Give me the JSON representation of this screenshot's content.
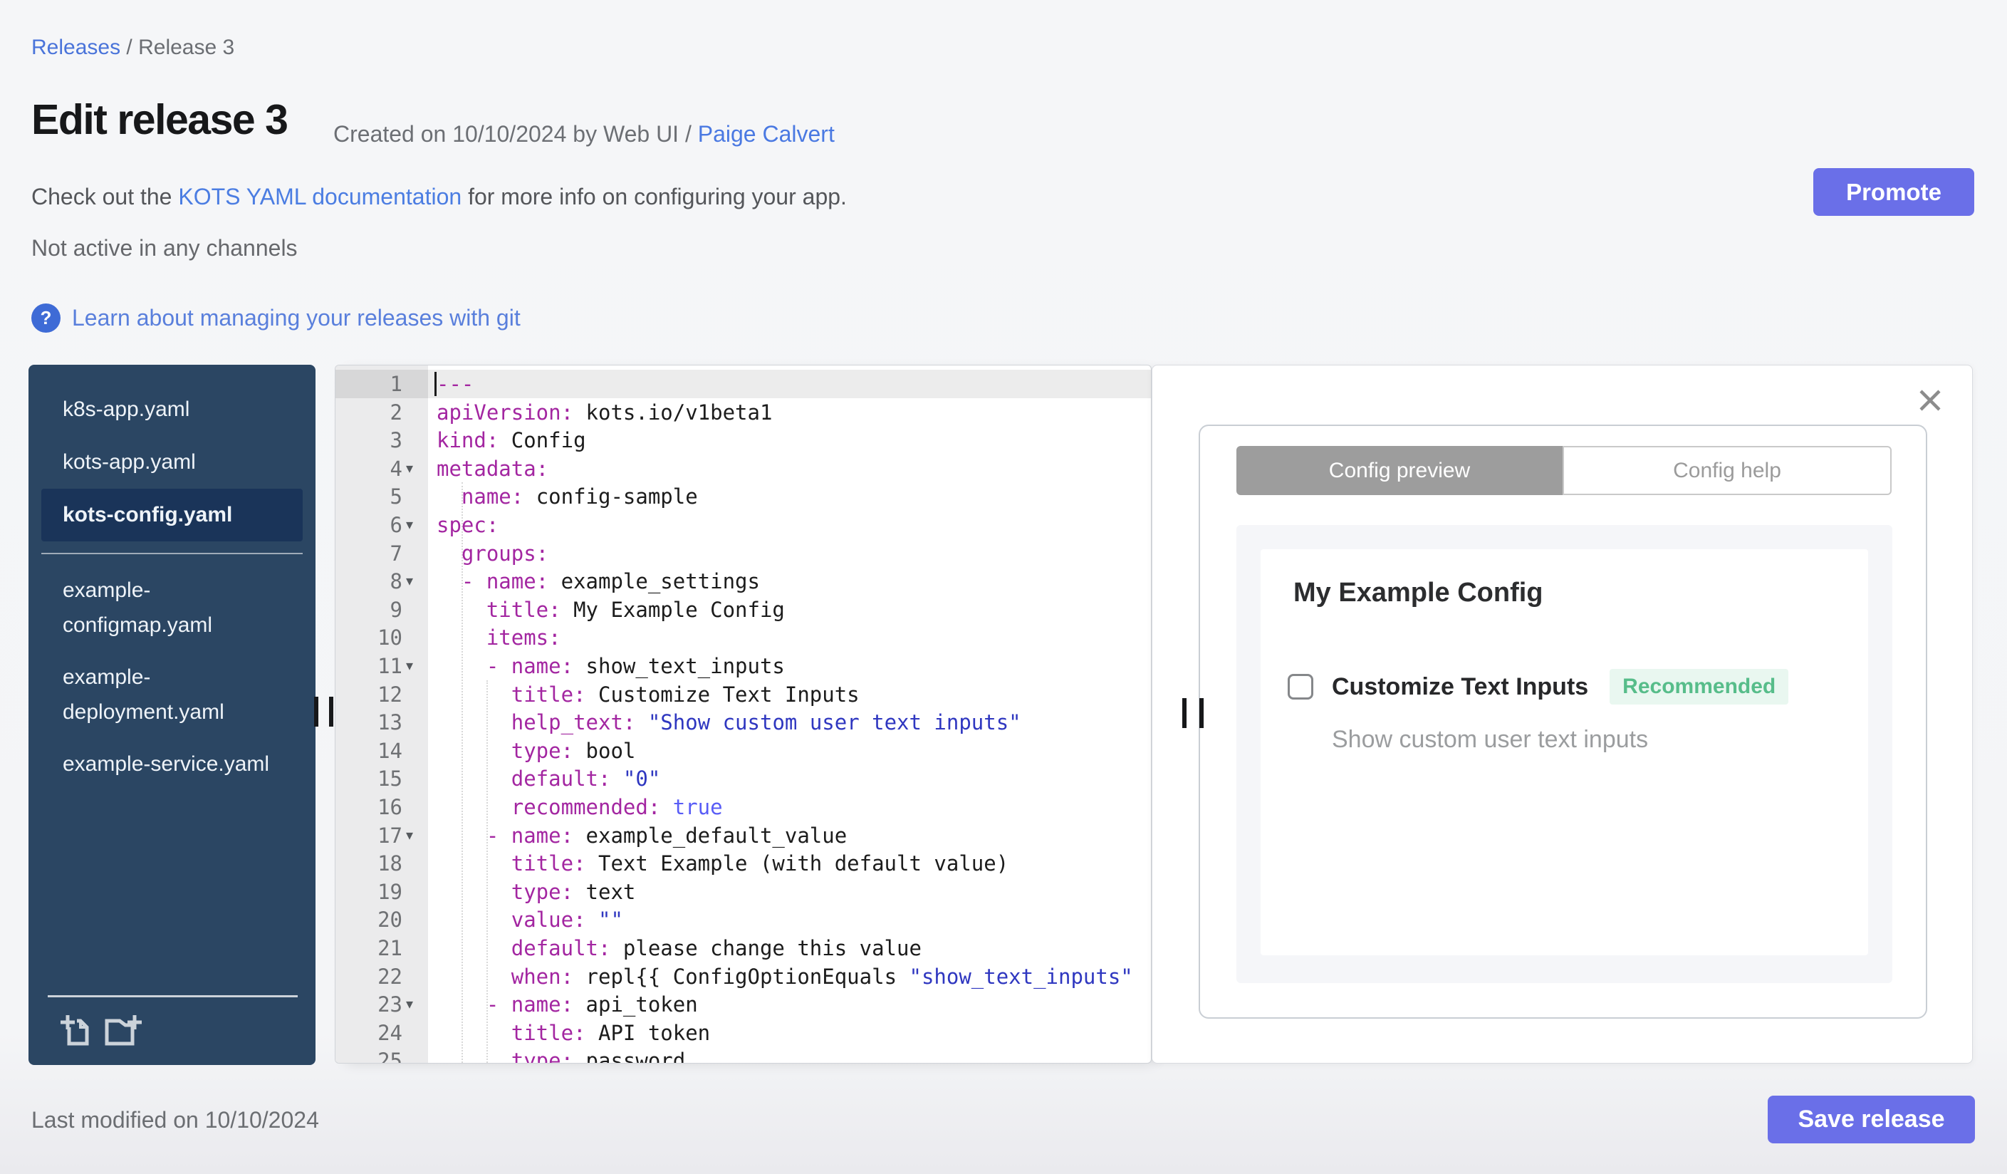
{
  "header": {
    "breadcrumb": {
      "releases": "Releases",
      "separator": " / ",
      "current": "Release 3"
    },
    "title": "Edit release 3",
    "created": {
      "prefix": "Created on 10/10/2024 by Web UI / ",
      "author": "Paige Calvert"
    },
    "docs": {
      "before": "Check out the ",
      "link": "KOTS YAML documentation",
      "after": " for more info on configuring your app."
    },
    "status": "Not active in any channels",
    "git_help": {
      "icon": "?",
      "label": "Learn about managing your releases with git"
    },
    "promote_label": "Promote"
  },
  "sidebar": {
    "files_top": [
      {
        "name": "k8s-app.yaml",
        "selected": false
      },
      {
        "name": "kots-app.yaml",
        "selected": false
      },
      {
        "name": "kots-config.yaml",
        "selected": true
      }
    ],
    "files_bottom": [
      {
        "name": "example-configmap.yaml"
      },
      {
        "name": "example-deployment.yaml"
      },
      {
        "name": "example-service.yaml"
      }
    ],
    "action_icons": [
      "add-file-icon",
      "upload-file-icon"
    ]
  },
  "editor": {
    "active_line": 1,
    "fold_lines": [
      4,
      6,
      8,
      11,
      17,
      23
    ],
    "fold_glyph": "▾",
    "lines": [
      [
        {
          "c": "key",
          "t": "---"
        }
      ],
      [
        {
          "c": "key",
          "t": "apiVersion:"
        },
        {
          "c": "plain",
          "t": " kots.io/v1beta1"
        }
      ],
      [
        {
          "c": "key",
          "t": "kind:"
        },
        {
          "c": "plain",
          "t": " Config"
        }
      ],
      [
        {
          "c": "key",
          "t": "metadata:"
        }
      ],
      [
        {
          "c": "plain",
          "t": "  "
        },
        {
          "c": "key",
          "t": "name:"
        },
        {
          "c": "plain",
          "t": " config-sample"
        }
      ],
      [
        {
          "c": "key",
          "t": "spec:"
        }
      ],
      [
        {
          "c": "plain",
          "t": "  "
        },
        {
          "c": "key",
          "t": "groups:"
        }
      ],
      [
        {
          "c": "plain",
          "t": "  "
        },
        {
          "c": "key",
          "t": "- name:"
        },
        {
          "c": "plain",
          "t": " example_settings"
        }
      ],
      [
        {
          "c": "plain",
          "t": "    "
        },
        {
          "c": "key",
          "t": "title:"
        },
        {
          "c": "plain",
          "t": " My Example Config"
        }
      ],
      [
        {
          "c": "plain",
          "t": "    "
        },
        {
          "c": "key",
          "t": "items:"
        }
      ],
      [
        {
          "c": "plain",
          "t": "    "
        },
        {
          "c": "key",
          "t": "- name:"
        },
        {
          "c": "plain",
          "t": " show_text_inputs"
        }
      ],
      [
        {
          "c": "plain",
          "t": "      "
        },
        {
          "c": "key",
          "t": "title:"
        },
        {
          "c": "plain",
          "t": " Customize Text Inputs"
        }
      ],
      [
        {
          "c": "plain",
          "t": "      "
        },
        {
          "c": "key",
          "t": "help_text:"
        },
        {
          "c": "plain",
          "t": " "
        },
        {
          "c": "str",
          "t": "\"Show custom user text inputs\""
        }
      ],
      [
        {
          "c": "plain",
          "t": "      "
        },
        {
          "c": "key",
          "t": "type:"
        },
        {
          "c": "plain",
          "t": " bool"
        }
      ],
      [
        {
          "c": "plain",
          "t": "      "
        },
        {
          "c": "key",
          "t": "default:"
        },
        {
          "c": "plain",
          "t": " "
        },
        {
          "c": "str",
          "t": "\"0\""
        }
      ],
      [
        {
          "c": "plain",
          "t": "      "
        },
        {
          "c": "key",
          "t": "recommended:"
        },
        {
          "c": "plain",
          "t": " "
        },
        {
          "c": "bool",
          "t": "true"
        }
      ],
      [
        {
          "c": "plain",
          "t": "    "
        },
        {
          "c": "key",
          "t": "- name:"
        },
        {
          "c": "plain",
          "t": " example_default_value"
        }
      ],
      [
        {
          "c": "plain",
          "t": "      "
        },
        {
          "c": "key",
          "t": "title:"
        },
        {
          "c": "plain",
          "t": " Text Example (with default value)"
        }
      ],
      [
        {
          "c": "plain",
          "t": "      "
        },
        {
          "c": "key",
          "t": "type:"
        },
        {
          "c": "plain",
          "t": " text"
        }
      ],
      [
        {
          "c": "plain",
          "t": "      "
        },
        {
          "c": "key",
          "t": "value:"
        },
        {
          "c": "plain",
          "t": " "
        },
        {
          "c": "str",
          "t": "\"\""
        }
      ],
      [
        {
          "c": "plain",
          "t": "      "
        },
        {
          "c": "key",
          "t": "default:"
        },
        {
          "c": "plain",
          "t": " please change this value"
        }
      ],
      [
        {
          "c": "plain",
          "t": "      "
        },
        {
          "c": "key",
          "t": "when:"
        },
        {
          "c": "plain",
          "t": " repl{{ ConfigOptionEquals "
        },
        {
          "c": "str",
          "t": "\"show_text_inputs\""
        }
      ],
      [
        {
          "c": "plain",
          "t": "    "
        },
        {
          "c": "key",
          "t": "- name:"
        },
        {
          "c": "plain",
          "t": " api_token"
        }
      ],
      [
        {
          "c": "plain",
          "t": "      "
        },
        {
          "c": "key",
          "t": "title:"
        },
        {
          "c": "plain",
          "t": " API token"
        }
      ],
      [
        {
          "c": "plain",
          "t": "      "
        },
        {
          "c": "key",
          "t": "type:"
        },
        {
          "c": "plain",
          "t": " password"
        }
      ]
    ]
  },
  "preview": {
    "tabs": [
      {
        "label": "Config preview",
        "active": true
      },
      {
        "label": "Config help",
        "active": false
      }
    ],
    "group_title": "My Example Config",
    "item": {
      "label": "Customize Text Inputs",
      "badge": "Recommended",
      "help": "Show custom user text inputs",
      "checked": false
    }
  },
  "footer": {
    "last_modified": "Last modified on 10/10/2024",
    "save_label": "Save release"
  },
  "colors": {
    "accent": "#6a6fe8",
    "link": "#4a79e2",
    "sidebar_bg": "#2b4663",
    "sidebar_selected": "#1a3459",
    "badge_text": "#57bd8a",
    "badge_bg": "#e9f7f0",
    "code_key": "#a326a1",
    "code_string": "#2f37c0",
    "code_boolean": "#585cf6"
  }
}
